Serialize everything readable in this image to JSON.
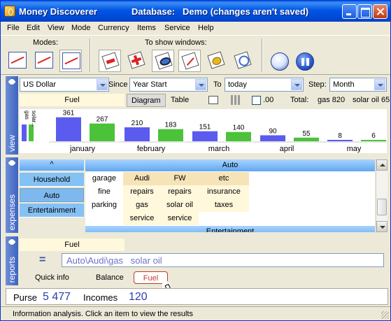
{
  "window": {
    "app_name": "Money Discoverer",
    "db_label": "Database:",
    "db_name": "Demo (changes aren't saved)"
  },
  "menu": [
    "File",
    "Edit",
    "View",
    "Mode",
    "Currency",
    "Items",
    "Service",
    "Help"
  ],
  "toolbar": {
    "modes_label": "Modes:",
    "windows_label": "To show windows:",
    "icons": {
      "mode1": "journal-icon",
      "mode2": "chart-mode-icon",
      "mode3": "analysis-icon",
      "win1": "expense-window-icon",
      "win2": "income-window-icon",
      "win3": "view-window-icon",
      "win4": "chart-window-icon",
      "win5": "coins-window-icon",
      "win6": "reminder-window-icon",
      "currency": "currency-icon",
      "pause": "pause-icon"
    }
  },
  "view": {
    "side_label": "view",
    "currency": "US Dollar",
    "since_label": "Since",
    "since_value": "Year Start",
    "to_label": "To",
    "to_value": "today",
    "step_label": "Step:",
    "step_value": "Month",
    "fuel_tab": "Fuel",
    "tab_diagram": "Diagram",
    "tab_table": "Table",
    "decimals_label": ".00",
    "total_label": "Total:",
    "total_gas": "gas 820",
    "total_solar": "solar oil 65",
    "legend_gas": "gas",
    "legend_solar": "solar..."
  },
  "chart_data": {
    "type": "bar",
    "categories": [
      "january",
      "february",
      "march",
      "april",
      "may"
    ],
    "series": [
      {
        "name": "gas",
        "values": [
          361,
          210,
          151,
          90,
          8
        ],
        "color": "#5b5bef"
      },
      {
        "name": "solar oil",
        "values": [
          267,
          183,
          140,
          55,
          6
        ],
        "color": "#4cc23a"
      }
    ],
    "ylim": [
      0,
      400
    ]
  },
  "expenses": {
    "side_label": "expenses",
    "up_arrow": "^",
    "categories": [
      "Household",
      "Auto",
      "Entertainment"
    ],
    "group_header": "Auto",
    "next_header": "Entertainment",
    "columns": [
      [
        "garage",
        "fine",
        "parking"
      ],
      [
        "Audi",
        "repairs",
        "gas",
        "service"
      ],
      [
        "FW",
        "repairs",
        "solar oil",
        "service"
      ],
      [
        "etc",
        "insurance",
        "taxes"
      ]
    ]
  },
  "reports": {
    "side_label": "reports",
    "fuel": "Fuel",
    "equals": "=",
    "path": "Auto\\Audi\\gas",
    "path_extra": "solar oil",
    "tab_quick": "Quick info",
    "tab_balance": "Balance",
    "tab_fuel": "Fuel"
  },
  "summary": {
    "purse_label": "Purse",
    "purse_value": "5 477",
    "incomes_label": "Incomes",
    "incomes_value": "120"
  },
  "status": "Information analysis. Click an item to view the results"
}
